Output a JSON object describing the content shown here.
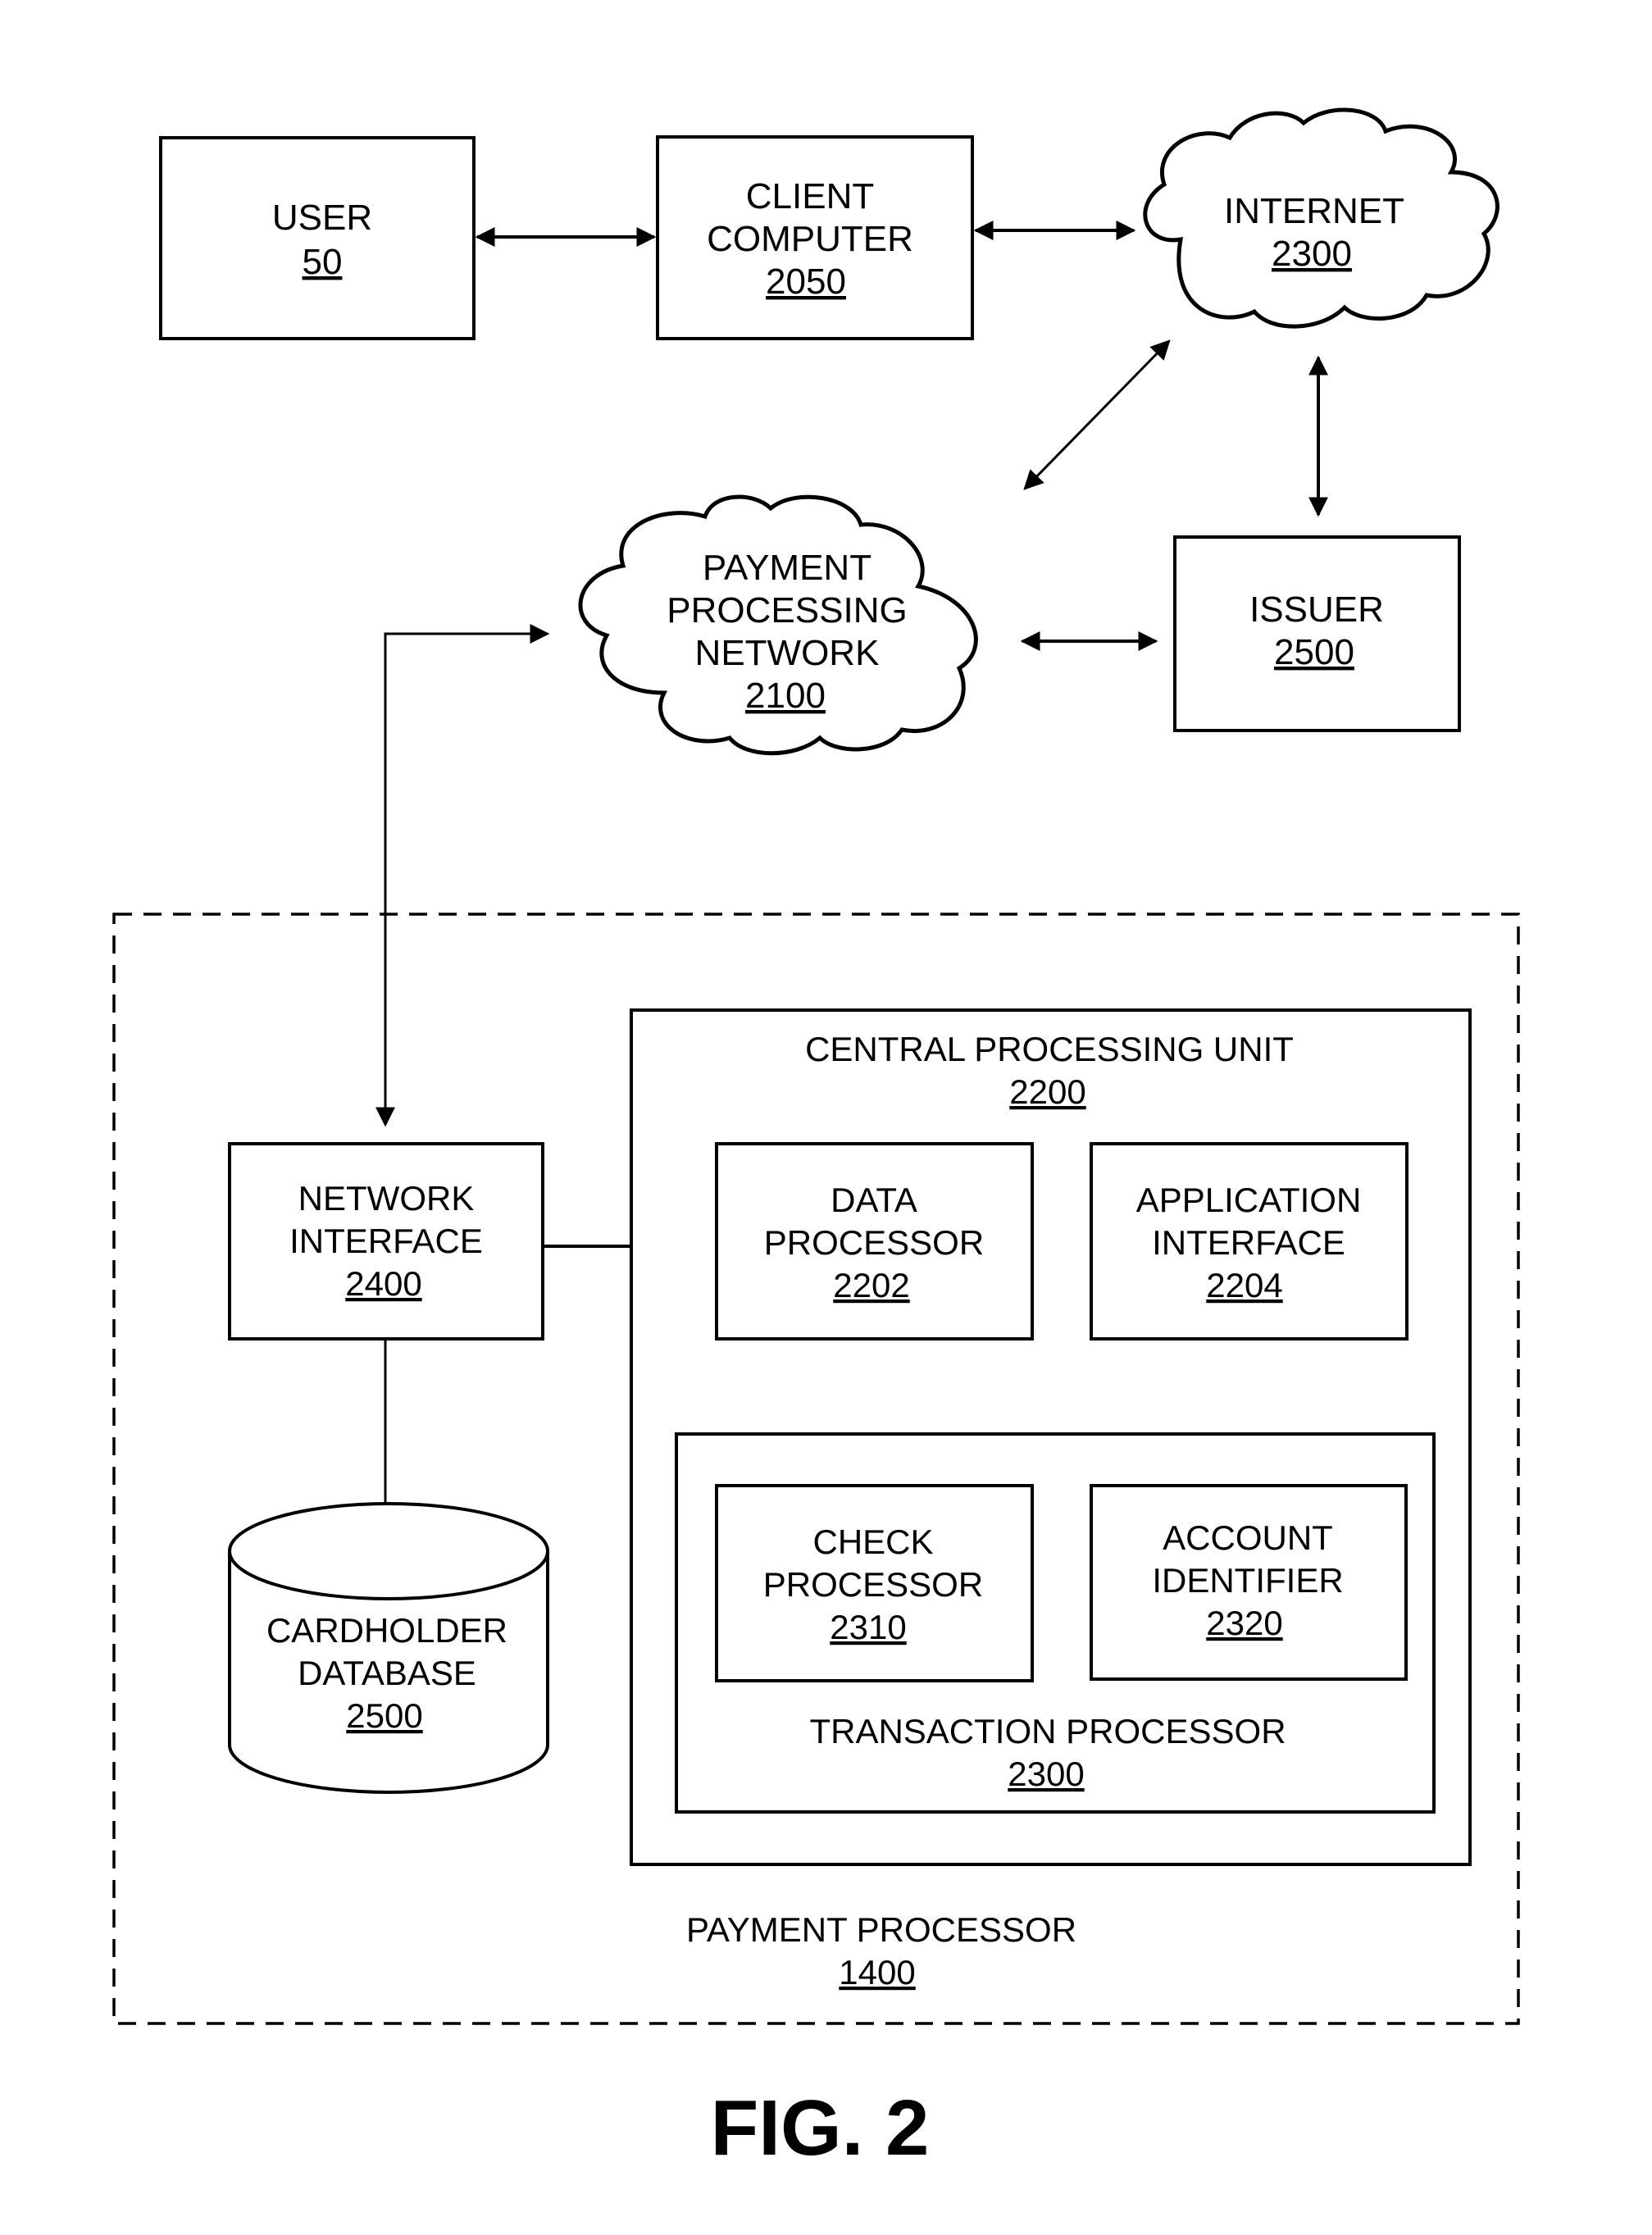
{
  "figure": {
    "caption": "FIG. 2",
    "type": "block diagram"
  },
  "nodes": {
    "user": {
      "lines": [
        "USER"
      ],
      "ref": "50"
    },
    "client_computer": {
      "lines": [
        "CLIENT",
        "COMPUTER"
      ],
      "ref": "2050"
    },
    "internet": {
      "lines": [
        "INTERNET"
      ],
      "ref": "2300"
    },
    "payment_processing_network": {
      "lines": [
        "PAYMENT",
        "PROCESSING",
        "NETWORK"
      ],
      "ref": "2100"
    },
    "issuer": {
      "lines": [
        "ISSUER"
      ],
      "ref": "2500"
    },
    "payment_processor": {
      "lines": [
        "PAYMENT PROCESSOR"
      ],
      "ref": "1400"
    },
    "central_processing_unit": {
      "lines": [
        "CENTRAL PROCESSING UNIT"
      ],
      "ref": "2200"
    },
    "network_interface": {
      "lines": [
        "NETWORK",
        "INTERFACE"
      ],
      "ref": "2400"
    },
    "data_processor": {
      "lines": [
        "DATA",
        "PROCESSOR"
      ],
      "ref": "2202"
    },
    "application_interface": {
      "lines": [
        "APPLICATION",
        "INTERFACE"
      ],
      "ref": "2204"
    },
    "transaction_processor": {
      "lines": [
        "TRANSACTION PROCESSOR"
      ],
      "ref": "2300"
    },
    "check_processor": {
      "lines": [
        "CHECK",
        "PROCESSOR"
      ],
      "ref": "2310"
    },
    "account_identifier": {
      "lines": [
        "ACCOUNT",
        "IDENTIFIER"
      ],
      "ref": "2320"
    },
    "cardholder_database": {
      "lines": [
        "CARDHOLDER",
        "DATABASE"
      ],
      "ref": "2500"
    }
  },
  "connections": [
    {
      "from": "user",
      "to": "client_computer",
      "type": "bidirectional-arrow"
    },
    {
      "from": "client_computer",
      "to": "internet",
      "type": "bidirectional-arrow"
    },
    {
      "from": "internet",
      "to": "payment_processing_network",
      "type": "bidirectional-arrow"
    },
    {
      "from": "internet",
      "to": "issuer",
      "type": "bidirectional-arrow"
    },
    {
      "from": "payment_processing_network",
      "to": "issuer",
      "type": "bidirectional-arrow"
    },
    {
      "from": "payment_processing_network",
      "to": "network_interface",
      "type": "bidirectional-arrow"
    },
    {
      "from": "network_interface",
      "to": "data_processor",
      "type": "line"
    },
    {
      "from": "data_processor",
      "to": "application_interface",
      "type": "line"
    },
    {
      "from": "application_interface",
      "to": "transaction_processor",
      "type": "line"
    },
    {
      "from": "network_interface",
      "to": "cardholder_database",
      "type": "line"
    }
  ]
}
